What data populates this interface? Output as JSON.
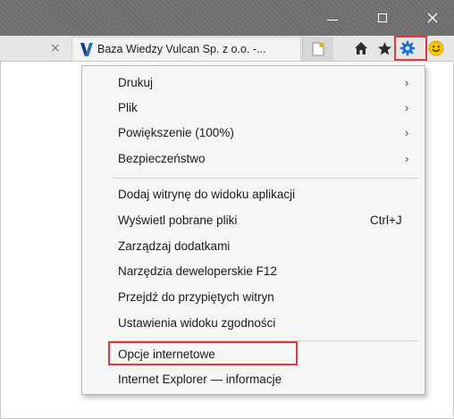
{
  "window": {
    "minimize_icon": "minimize-icon",
    "maximize_icon": "maximize-icon",
    "close_icon": "close-icon"
  },
  "tabs": {
    "prev_tab_close": "×",
    "active_tab_title": "Baza Wiedzy Vulcan Sp. z o.o. -...",
    "favicon": "vulcan-logo-icon",
    "new_tab_icon": "new-tab-icon"
  },
  "toolbar": {
    "icons": [
      "home-icon",
      "favorites-star-icon",
      "tools-gear-icon",
      "feedback-smiley-icon"
    ],
    "highlight_color": "#e8343a"
  },
  "menu": {
    "groups": [
      {
        "items": [
          {
            "label": "Drukuj",
            "submenu": true
          },
          {
            "label": "Plik",
            "submenu": true
          },
          {
            "label": "Powiększenie (100%)",
            "submenu": true
          },
          {
            "label": "Bezpieczeństwo",
            "submenu": true
          }
        ]
      },
      {
        "items": [
          {
            "label": "Dodaj witrynę do widoku aplikacji"
          },
          {
            "label": "Wyświetl pobrane pliki",
            "shortcut": "Ctrl+J"
          },
          {
            "label": "Zarządzaj dodatkami"
          },
          {
            "label": "Narzędzia deweloperskie F12"
          },
          {
            "label": "Przejdź do przypiętych witryn"
          },
          {
            "label": "Ustawienia widoku zgodności"
          }
        ]
      },
      {
        "items": [
          {
            "label": "Opcje internetowe",
            "highlighted": true
          },
          {
            "label": "Internet Explorer — informacje"
          }
        ]
      }
    ],
    "submenu_arrow": "›"
  }
}
